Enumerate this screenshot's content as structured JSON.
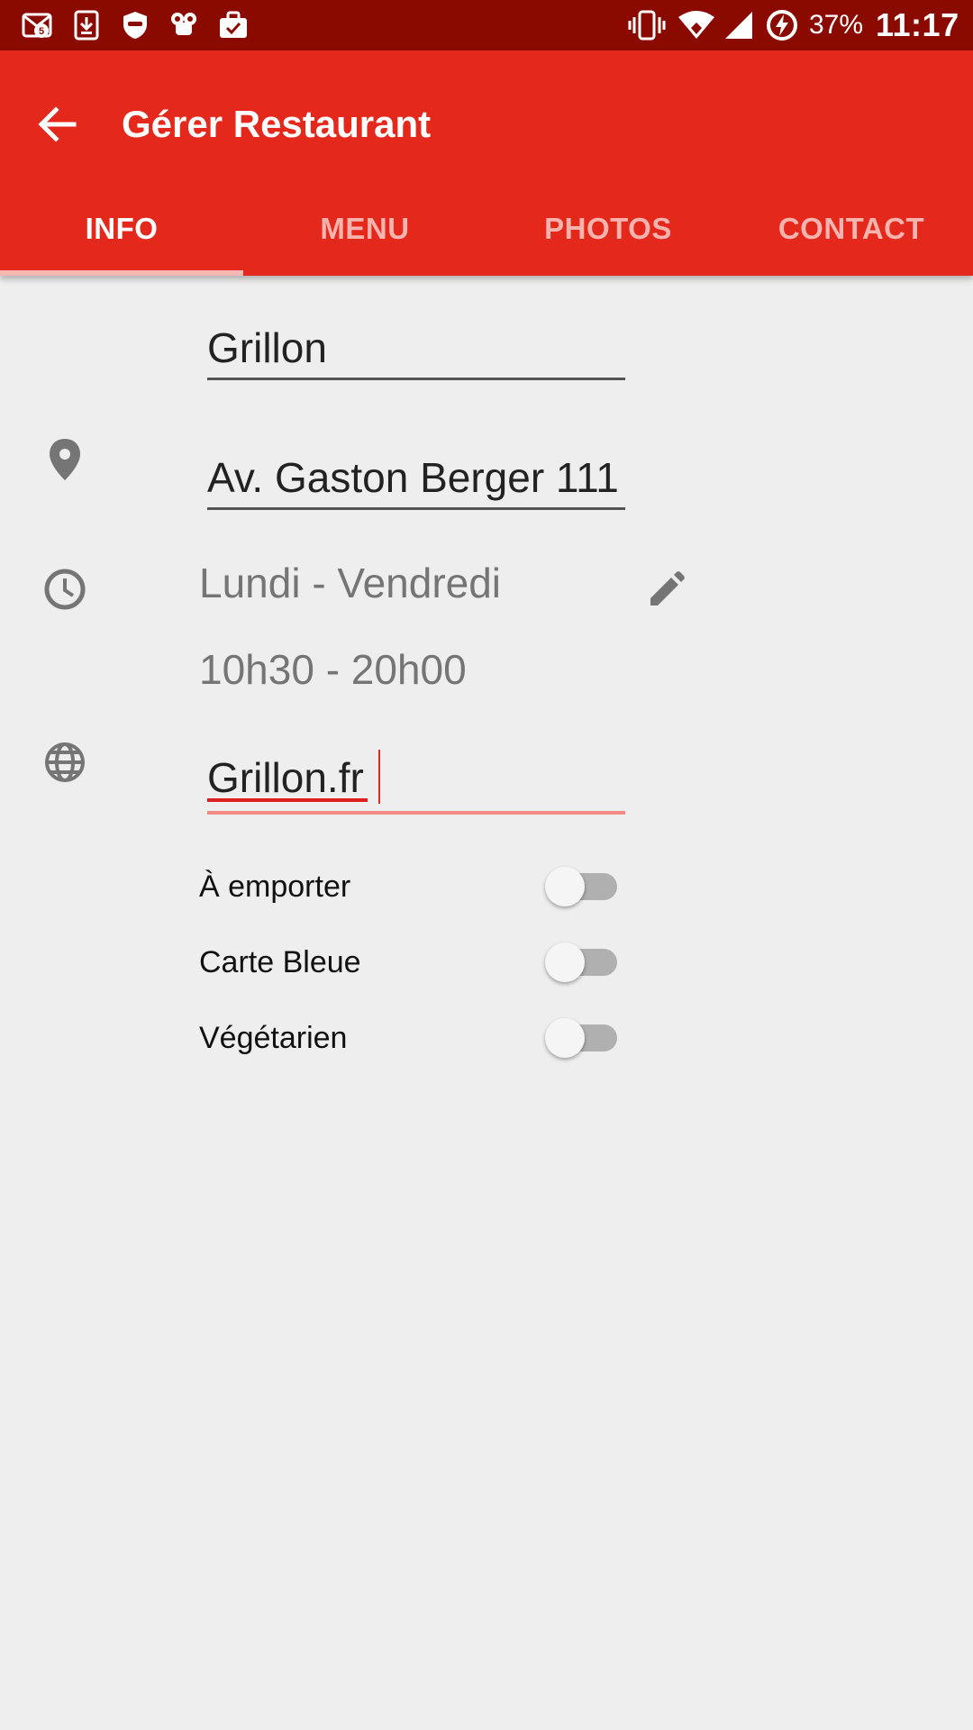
{
  "status_bar": {
    "notification_icons": [
      "mail-badge-icon",
      "download-icon",
      "shield-mask-icon",
      "robot-icon",
      "briefcase-check-icon"
    ],
    "battery_percent": "37%",
    "time": "11:17"
  },
  "app_bar": {
    "title": "Gérer Restaurant",
    "tabs": [
      {
        "label": "INFO",
        "active": true
      },
      {
        "label": "MENU",
        "active": false
      },
      {
        "label": "PHOTOS",
        "active": false
      },
      {
        "label": "CONTACT",
        "active": false
      }
    ]
  },
  "form": {
    "name": "Grillon",
    "address": "Av. Gaston Berger 111",
    "hours_days": "Lundi - Vendredi",
    "hours_time": "10h30 - 20h00",
    "website": "Grillon.fr",
    "options": [
      {
        "label": "À emporter",
        "enabled": false
      },
      {
        "label": "Carte Bleue",
        "enabled": false
      },
      {
        "label": "Végétarien",
        "enabled": false
      }
    ]
  },
  "colors": {
    "status_bar": "#8b0a00",
    "app_bar": "#e4281b",
    "background": "#eeeeee"
  }
}
